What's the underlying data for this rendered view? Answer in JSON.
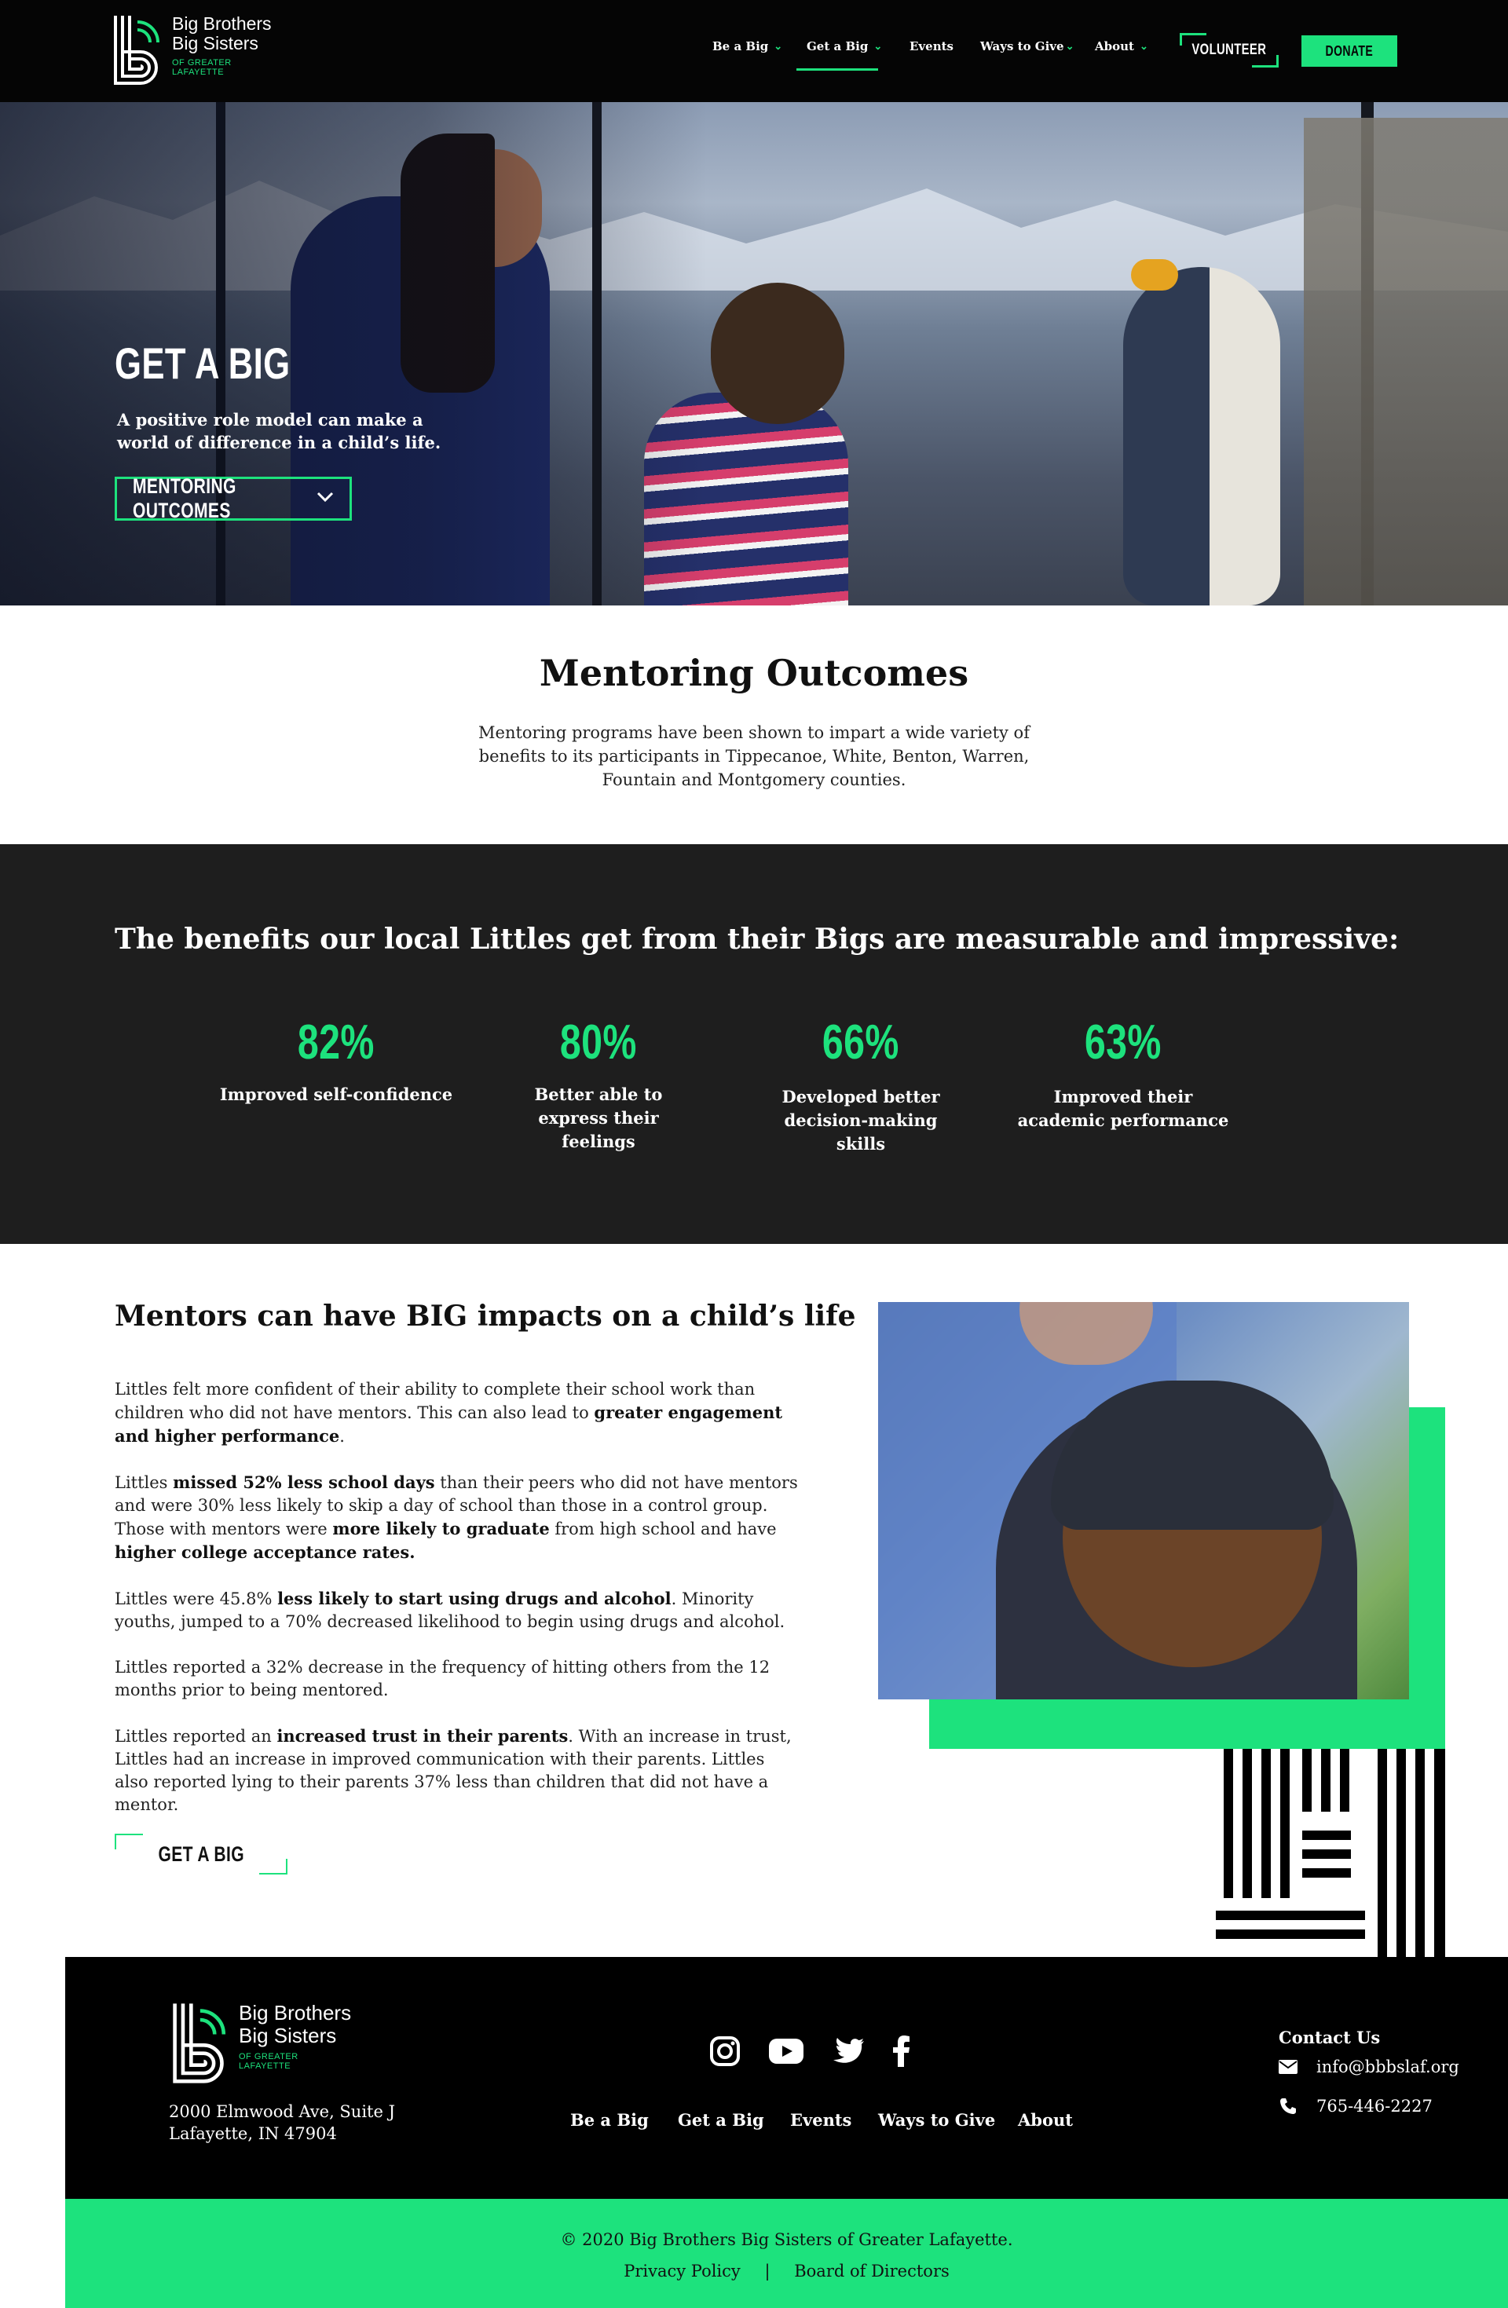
{
  "header": {
    "logo": {
      "line1": "Big Brothers",
      "line2": "Big Sisters",
      "line3": "OF GREATER",
      "line4": "LAFAYETTE"
    },
    "nav": [
      {
        "label": "Be a Big",
        "has_dropdown": true
      },
      {
        "label": "Get a Big",
        "has_dropdown": true,
        "active": true
      },
      {
        "label": "Events",
        "has_dropdown": false
      },
      {
        "label": "Ways to Give",
        "has_dropdown": true
      },
      {
        "label": "About",
        "has_dropdown": true
      }
    ],
    "volunteer_label": "VOLUNTEER",
    "donate_label": "DONATE"
  },
  "hero": {
    "title": "GET A BIG",
    "subtitle": "A positive role model can make a world of difference in a child’s life.",
    "button_label": "MENTORING OUTCOMES"
  },
  "intro": {
    "title": "Mentoring Outcomes",
    "text": "Mentoring programs have been shown to impart a wide variety of benefits to its participants in Tippecanoe, White, Benton, Warren, Fountain and Montgomery counties."
  },
  "stats": {
    "title": "The benefits our local Littles get from their Bigs are measurable and impressive:",
    "items": [
      {
        "value": "82%",
        "label": "Improved self-confidence"
      },
      {
        "value": "80%",
        "label": "Better able to express their feelings"
      },
      {
        "value": "66%",
        "label": "Developed better decision-making skills"
      },
      {
        "value": "63%",
        "label": "Improved their academic performance"
      }
    ]
  },
  "impact": {
    "title": "Mentors can have BIG impacts on a child’s life",
    "p1a": "Littles felt more confident of their ability to complete their school work than children who did not have mentors. This can also lead to ",
    "p1b": "greater engagement and higher performance",
    "p1c": ".",
    "p2a": "Littles ",
    "p2b": "missed 52% less school days",
    "p2c": " than their peers who did not have mentors and were 30% less likely to skip a day of school than those in a control group. Those with mentors were ",
    "p2d": "more likely to graduate",
    "p2e": " from high school and have ",
    "p2f": "higher college acceptance rates.",
    "p3a": "Littles were 45.8% ",
    "p3b": "less likely to start using drugs and alcohol",
    "p3c": ". Minority youths, jumped to a 70% decreased likelihood to begin using drugs and alcohol.",
    "p4": "Littles reported a 32% decrease in the frequency of hitting others from the 12 months prior to being mentored.",
    "p5a": "Littles reported an ",
    "p5b": "increased trust in their parents",
    "p5c": ". With an increase in trust, Littles had an increase in improved communication with their parents.  Littles also reported lying to their parents 37% less than children that did not have a mentor.",
    "button_label": "GET A BIG"
  },
  "footer": {
    "address_line1": "2000 Elmwood Ave, Suite J",
    "address_line2": "Lafayette, IN 47904",
    "social_icons": [
      "instagram-icon",
      "youtube-icon",
      "twitter-icon",
      "facebook-icon"
    ],
    "nav": [
      "Be a Big",
      "Get a Big",
      "Events",
      "Ways to Give",
      "About"
    ],
    "contact_title": "Contact Us",
    "email": "info@bbbslaf.org",
    "phone": "765-446-2227",
    "copyright": "© 2020 Big Brothers Big Sisters of Greater Lafayette.",
    "privacy_label": "Privacy Policy",
    "separator": "|",
    "board_label": "Board of Directors"
  },
  "colors": {
    "accent": "#1de27d",
    "dark": "#1e1e1e",
    "black": "#050505"
  }
}
